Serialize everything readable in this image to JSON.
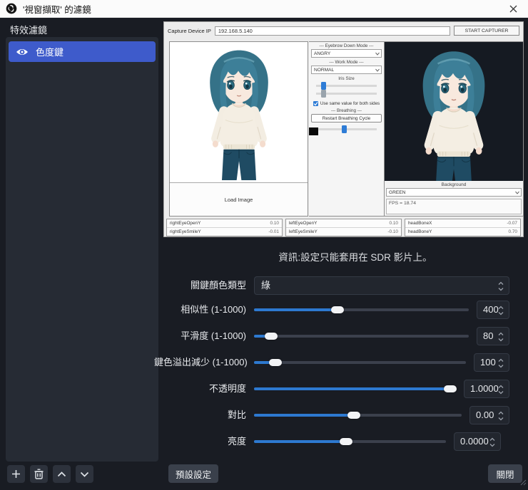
{
  "window": {
    "title": "'視窗擷取' 的濾鏡"
  },
  "sidebar": {
    "header": "特效濾鏡",
    "filters": [
      {
        "label": "色度鍵"
      }
    ]
  },
  "preview": {
    "toolbar": {
      "ip_label": "Capture Device IP",
      "ip_value": "192.168.5.140",
      "start_button": "START CAPTURER"
    },
    "left_panel": {
      "load_image": "Load Image"
    },
    "controls": {
      "eyebrow_header": "--- Eyebrow Down Mode ---",
      "eyebrow_value": "ANGRY",
      "work_mode_header": "--- Work Mode ---",
      "work_mode_value": "NORMAL",
      "iris_header": "Iris Size",
      "same_value_label": "Use same value for both sides",
      "breathing_header": "--- Breathing ---",
      "restart_button": "Restart Breathing Cycle"
    },
    "right_panel": {
      "background_label": "Background",
      "background_value": "GREEN",
      "fps": "FPS = 18.74"
    },
    "status": [
      {
        "name": "rightEyeOpenY",
        "value": "0.10"
      },
      {
        "name": "rightEyeSmileY",
        "value": "-0.01"
      },
      {
        "name": "leftEyeOpenY",
        "value": "0.10"
      },
      {
        "name": "leftEyeSmileY",
        "value": "-0.10"
      },
      {
        "name": "headBoneX",
        "value": "-0.07"
      },
      {
        "name": "headBoneY",
        "value": "0.70"
      }
    ]
  },
  "settings": {
    "info": "資訊:設定只能套用在 SDR 影片上。",
    "key_color": {
      "label": "關鍵顏色類型",
      "value": "綠"
    },
    "sliders": [
      {
        "label": "相似性 (1-1000)",
        "value": "400",
        "percent": 39
      },
      {
        "label": "平滑度 (1-1000)",
        "value": "80",
        "percent": 8
      },
      {
        "label": "鍵色溢出減少 (1-1000)",
        "value": "100",
        "percent": 10
      },
      {
        "label": "不透明度",
        "value": "1.0000",
        "percent": 97
      },
      {
        "label": "對比",
        "value": "0.00",
        "percent": 48
      },
      {
        "label": "亮度",
        "value": "0.0000",
        "percent": 48
      }
    ]
  },
  "footer": {
    "defaults": "預設設定",
    "close": "關閉"
  },
  "colors": {
    "selected_filter": "#3e5bcb",
    "slider_fill": "#2d79d0",
    "titlebar_bg": "#fbfbfb",
    "dialog_bg": "#191c23",
    "panel_bg": "#262b34"
  }
}
